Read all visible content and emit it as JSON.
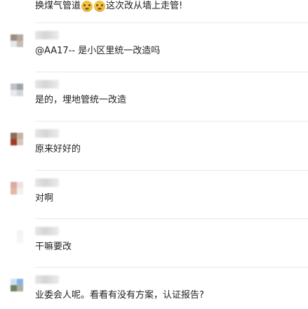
{
  "thread": {
    "top_message": {
      "text_before": "换煤气管道",
      "emoji_icons": [
        "grinning-face-icon",
        "grinning-face-icon"
      ],
      "text_after": "这次改从墙上走管!"
    },
    "comments": [
      {
        "text": "@AA17-- 是小区里统一改造吗",
        "avatar_colors": [
          "#9b8b80",
          "#b5a69e",
          "#e8e8e8",
          "#c6bbb6"
        ]
      },
      {
        "text": "是的，埋地管统一改造",
        "avatar_colors": [
          "#bfc2c7",
          "#9ea3a8",
          "#e7e9eb",
          "#d4d7da"
        ]
      },
      {
        "text": "原来好好的",
        "avatar_colors": [
          "#8a6b57",
          "#c7b1a1",
          "#9d3b23",
          "#d8c4b7"
        ]
      },
      {
        "text": "对啊",
        "avatar_colors": [
          "#d9aca3",
          "#efe2de",
          "#e8b6a9",
          "#f5f0ee"
        ]
      },
      {
        "text": "干嘛要改",
        "avatar_colors": [
          "#ffffff",
          "#f3f3f3",
          "#ffffff",
          "#f6f6f6"
        ]
      },
      {
        "text": "业委会人呢。看看有没有方案，认证报告?",
        "avatar_colors": [
          "#cddff4",
          "#8bb2de",
          "#6f8063",
          "#a7b1a2"
        ]
      }
    ]
  },
  "colors": {
    "background": "#ffffff",
    "text": "#222222",
    "divider": "#e9e9e9",
    "emoji": "#f2c040"
  }
}
